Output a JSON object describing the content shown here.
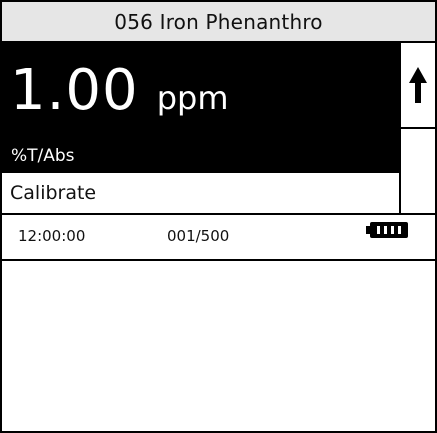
{
  "header": {
    "title": "056 Iron Phenanthro"
  },
  "reading": {
    "value": "1.00",
    "unit": "ppm"
  },
  "mode": {
    "label": "%T/Abs"
  },
  "menu": {
    "calibrate_label": "Calibrate"
  },
  "status": {
    "time": "12:00:00",
    "record_count": "001/500",
    "battery_icon": "battery-full-icon"
  },
  "icons": {
    "scroll_up": "arrow-up-icon"
  }
}
